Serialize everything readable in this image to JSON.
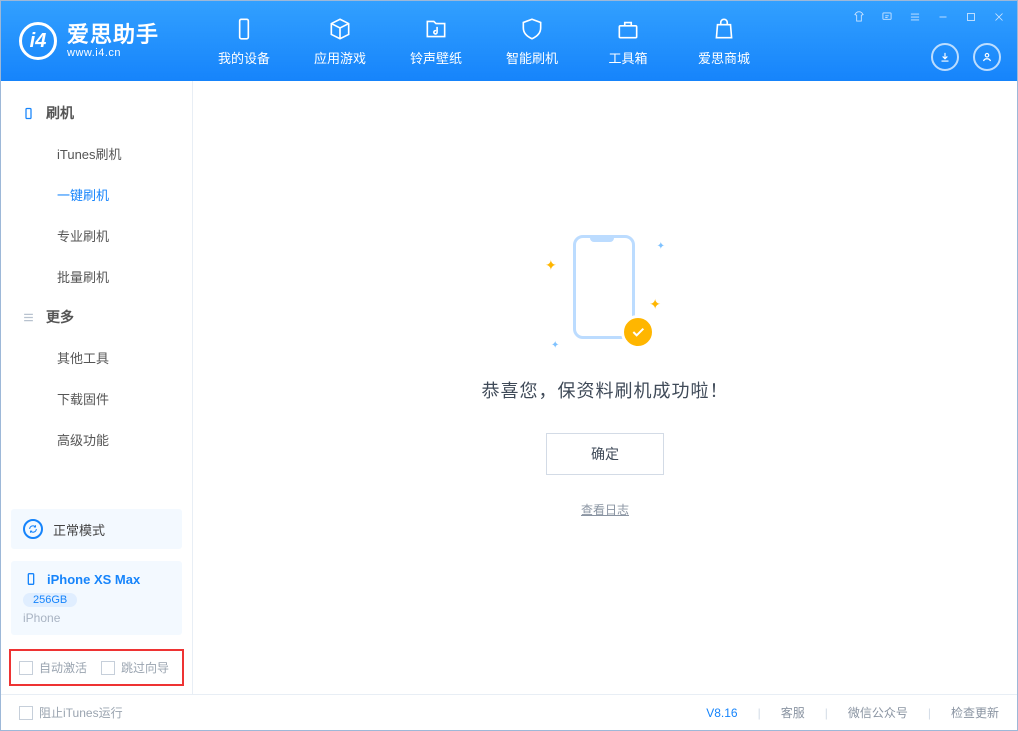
{
  "brand": {
    "name": "爱思助手",
    "url": "www.i4.cn"
  },
  "tabs": [
    "我的设备",
    "应用游戏",
    "铃声壁纸",
    "智能刷机",
    "工具箱",
    "爱思商城"
  ],
  "sidebar": {
    "group1": {
      "title": "刷机",
      "items": [
        "iTunes刷机",
        "一键刷机",
        "专业刷机",
        "批量刷机"
      ],
      "active_index": 1
    },
    "group2": {
      "title": "更多",
      "items": [
        "其他工具",
        "下载固件",
        "高级功能"
      ]
    }
  },
  "mode": {
    "label": "正常模式"
  },
  "device": {
    "name": "iPhone XS Max",
    "capacity": "256GB",
    "type": "iPhone"
  },
  "options": {
    "auto_activate": "自动激活",
    "skip_guide": "跳过向导"
  },
  "result": {
    "message": "恭喜您，保资料刷机成功啦！",
    "ok": "确定",
    "view_log": "查看日志"
  },
  "footer": {
    "block_itunes": "阻止iTunes运行",
    "version": "V8.16",
    "links": [
      "客服",
      "微信公众号",
      "检查更新"
    ]
  }
}
